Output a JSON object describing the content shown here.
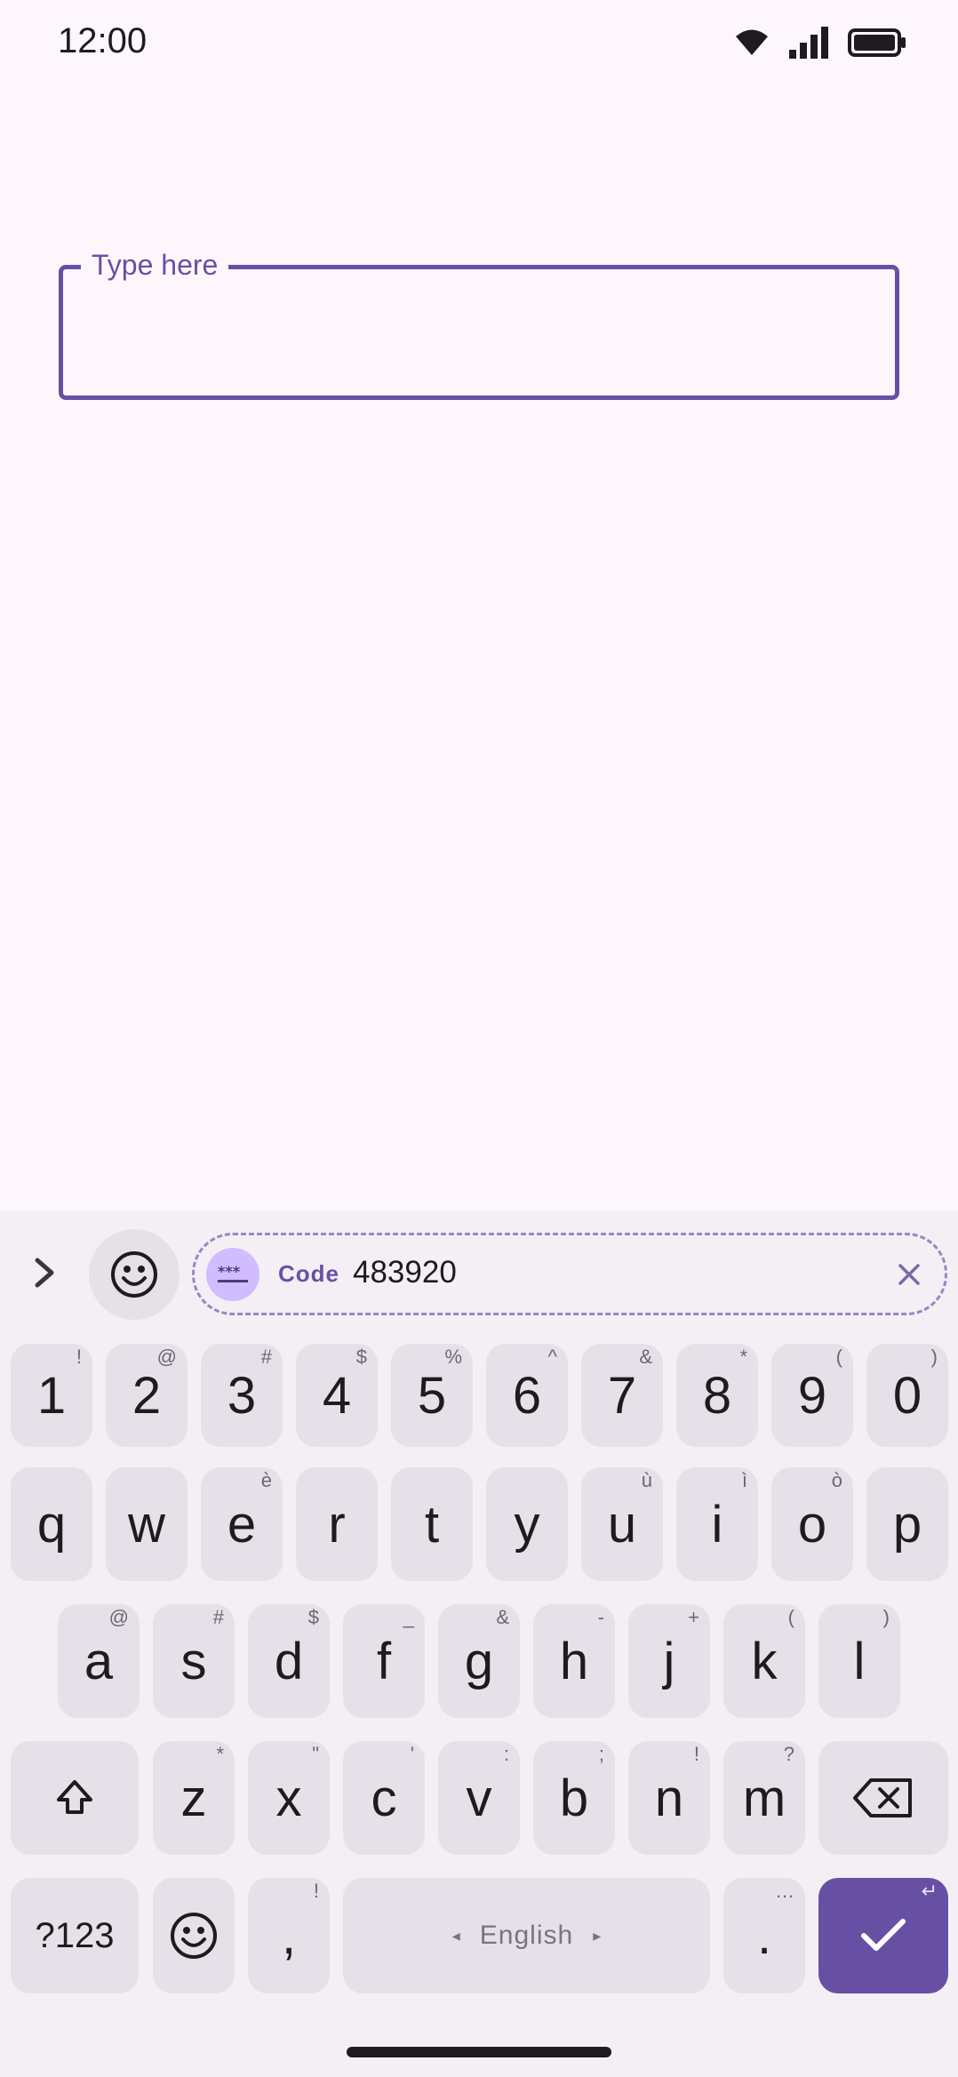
{
  "status_bar": {
    "time": "12:00",
    "icons": [
      "wifi-icon",
      "signal-icon",
      "battery-icon"
    ]
  },
  "text_field": {
    "label": "Type here",
    "value": ""
  },
  "suggestion_strip": {
    "chip_label": "Code",
    "chip_value": "483920"
  },
  "keyboard": {
    "number_row": [
      {
        "key": "1",
        "hint": "!"
      },
      {
        "key": "2",
        "hint": "@"
      },
      {
        "key": "3",
        "hint": "#"
      },
      {
        "key": "4",
        "hint": "$"
      },
      {
        "key": "5",
        "hint": "%"
      },
      {
        "key": "6",
        "hint": "^"
      },
      {
        "key": "7",
        "hint": "&"
      },
      {
        "key": "8",
        "hint": "*"
      },
      {
        "key": "9",
        "hint": "("
      },
      {
        "key": "0",
        "hint": ")"
      }
    ],
    "row1": [
      {
        "key": "q",
        "hint": ""
      },
      {
        "key": "w",
        "hint": ""
      },
      {
        "key": "e",
        "hint": "è"
      },
      {
        "key": "r",
        "hint": ""
      },
      {
        "key": "t",
        "hint": ""
      },
      {
        "key": "y",
        "hint": ""
      },
      {
        "key": "u",
        "hint": "ù"
      },
      {
        "key": "i",
        "hint": "ì"
      },
      {
        "key": "o",
        "hint": "ò"
      },
      {
        "key": "p",
        "hint": ""
      }
    ],
    "row2": [
      {
        "key": "a",
        "hint": "@"
      },
      {
        "key": "s",
        "hint": "#"
      },
      {
        "key": "d",
        "hint": "$"
      },
      {
        "key": "f",
        "hint": "_"
      },
      {
        "key": "g",
        "hint": "&"
      },
      {
        "key": "h",
        "hint": "-"
      },
      {
        "key": "j",
        "hint": "+"
      },
      {
        "key": "k",
        "hint": "("
      },
      {
        "key": "l",
        "hint": ")"
      }
    ],
    "row3": [
      {
        "key": "z",
        "hint": "*"
      },
      {
        "key": "x",
        "hint": "\""
      },
      {
        "key": "c",
        "hint": "'"
      },
      {
        "key": "v",
        "hint": ":"
      },
      {
        "key": "b",
        "hint": ";"
      },
      {
        "key": "n",
        "hint": "!"
      },
      {
        "key": "m",
        "hint": "?"
      }
    ],
    "symbols_label": "?123",
    "comma": ",",
    "comma_hint": "!",
    "space_label": "English",
    "space_left_arrow": "◂",
    "space_right_arrow": "▸",
    "period": ".",
    "period_hint": "…",
    "enter_hint": "↵"
  },
  "colors": {
    "accent": "#6750a4",
    "background": "#fdf7fc",
    "keyboard_bg": "#f4eff4",
    "key_bg": "#e6e0e9"
  }
}
